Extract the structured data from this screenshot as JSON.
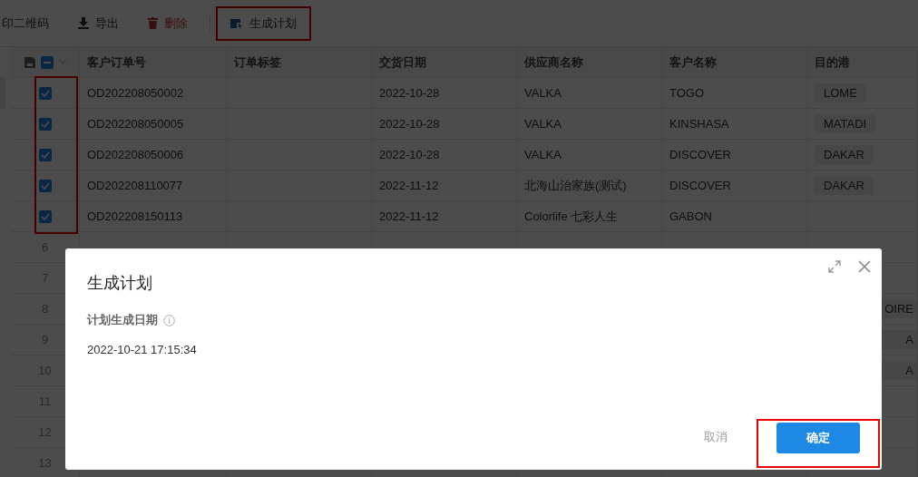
{
  "toolbar": [
    {
      "label": "印二维码",
      "kind": "normal",
      "highlighted": false
    },
    {
      "label": "导出",
      "kind": "normal",
      "highlighted": false
    },
    {
      "label": "删除",
      "kind": "danger",
      "highlighted": false
    },
    {
      "label": "生成计划",
      "kind": "normal",
      "highlighted": true
    }
  ],
  "table": {
    "columns": [
      "客户订单号",
      "订单标签",
      "交货日期",
      "供应商名称",
      "客户名称",
      "目的港"
    ],
    "select_all_indeterminate": true,
    "checkbox_highlighted": true,
    "rows": [
      {
        "checked": true,
        "cells": [
          "OD202208050002",
          "",
          "2022-10-28",
          "VALKA",
          "TOGO"
        ],
        "port": "LOME",
        "port_cut": false
      },
      {
        "checked": true,
        "cells": [
          "OD202208050005",
          "",
          "2022-10-28",
          "VALKA",
          "KINSHASA"
        ],
        "port": "MATADI",
        "port_cut": false
      },
      {
        "checked": true,
        "cells": [
          "OD202208050006",
          "",
          "2022-10-28",
          "VALKA",
          "DISCOVER"
        ],
        "port": "DAKAR",
        "port_cut": false
      },
      {
        "checked": true,
        "cells": [
          "OD202208110077",
          "",
          "2022-11-12",
          "北海山治家族(测试)",
          "DISCOVER"
        ],
        "port": "DAKAR",
        "port_cut": false
      },
      {
        "checked": true,
        "cells": [
          "OD202208150113",
          "",
          "2022-11-12",
          "Colorlife 七彩人生",
          "GABON"
        ]
      },
      {
        "index": "6",
        "checked": false,
        "cells": [
          "",
          "",
          "",
          "",
          ""
        ]
      },
      {
        "index": "7",
        "checked": false,
        "cells": [
          "",
          "",
          "",
          "",
          ""
        ]
      },
      {
        "index": "8",
        "checked": false,
        "cells": [
          "",
          "",
          "",
          "",
          ""
        ],
        "port": "OIRE",
        "port_cut": true
      },
      {
        "index": "9",
        "checked": false,
        "cells": [
          "",
          "",
          "",
          "",
          ""
        ],
        "port": "A",
        "port_cut": true
      },
      {
        "index": "10",
        "checked": false,
        "cells": [
          "",
          "",
          "",
          "",
          ""
        ],
        "port": "A",
        "port_cut": true
      },
      {
        "index": "11",
        "checked": false,
        "cells": [
          "",
          "",
          "",
          "",
          ""
        ]
      },
      {
        "index": "12",
        "checked": false,
        "cells": [
          "",
          "",
          "",
          "",
          ""
        ]
      },
      {
        "index": "13",
        "checked": false,
        "cells": [
          "",
          "",
          "",
          "",
          ""
        ]
      }
    ]
  },
  "dialog": {
    "title": "生成计划",
    "field_label": "计划生成日期",
    "field_value": "2022-10-21 17:15:34",
    "cancel": "取消",
    "confirm": "确定",
    "confirm_highlighted": true
  }
}
